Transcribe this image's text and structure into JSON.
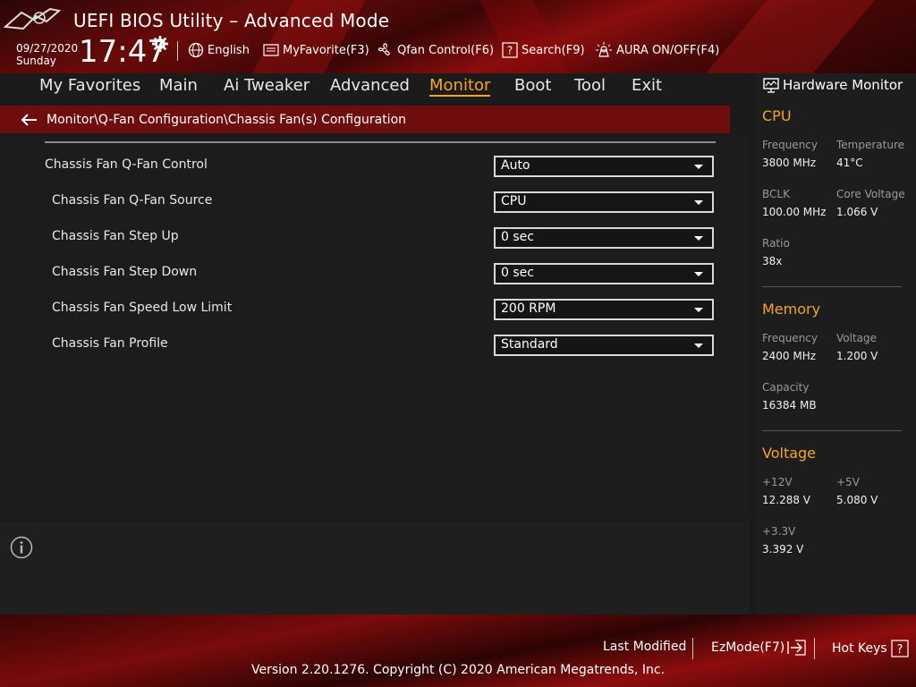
{
  "header": {
    "title": "UEFI BIOS Utility – Advanced Mode",
    "date": "09/27/2020",
    "day": "Sunday",
    "time": "17:47",
    "toolbar": [
      {
        "label": "English",
        "icon": "globe-icon"
      },
      {
        "label": "MyFavorite(F3)",
        "icon": "favorite-icon"
      },
      {
        "label": "Qfan Control(F6)",
        "icon": "fan-icon"
      },
      {
        "label": "Search(F9)",
        "icon": "search-icon"
      },
      {
        "label": "AURA ON/OFF(F4)",
        "icon": "aura-icon"
      }
    ]
  },
  "nav": {
    "items": [
      "My Favorites",
      "Main",
      "Ai Tweaker",
      "Advanced",
      "Monitor",
      "Boot",
      "Tool",
      "Exit"
    ],
    "active": "Monitor"
  },
  "breadcrumb": "Monitor\\Q-Fan Configuration\\Chassis Fan(s) Configuration",
  "settings": [
    {
      "label": "Chassis Fan Q-Fan Control",
      "value": "Auto"
    },
    {
      "label": "Chassis Fan Q-Fan Source",
      "value": "CPU"
    },
    {
      "label": "Chassis Fan Step Up",
      "value": "0 sec"
    },
    {
      "label": "Chassis Fan Step Down",
      "value": "0 sec"
    },
    {
      "label": "Chassis Fan Speed Low Limit",
      "value": "200 RPM"
    },
    {
      "label": "Chassis Fan Profile",
      "value": "Standard"
    }
  ],
  "hw_monitor": {
    "title": "Hardware Monitor",
    "cpu": {
      "heading": "CPU",
      "frequency_label": "Frequency",
      "frequency": "3800 MHz",
      "temperature_label": "Temperature",
      "temperature": "41°C",
      "bclk_label": "BCLK",
      "bclk": "100.00 MHz",
      "core_voltage_label": "Core Voltage",
      "core_voltage": "1.066 V",
      "ratio_label": "Ratio",
      "ratio": "38x"
    },
    "memory": {
      "heading": "Memory",
      "frequency_label": "Frequency",
      "frequency": "2400 MHz",
      "voltage_label": "Voltage",
      "voltage": "1.200 V",
      "capacity_label": "Capacity",
      "capacity": "16384 MB"
    },
    "voltage": {
      "heading": "Voltage",
      "v12_label": "+12V",
      "v12": "12.288 V",
      "v5_label": "+5V",
      "v5": "5.080 V",
      "v33_label": "+3.3V",
      "v33": "3.392 V"
    }
  },
  "footer": {
    "last_modified": "Last Modified",
    "ezmode": "EzMode(F7)",
    "hot_keys": "Hot Keys",
    "copyright": "Version 2.20.1276. Copyright (C) 2020 American Megatrends, Inc."
  },
  "colors": {
    "accent": "#f5a623",
    "breadcrumb_bg": "#6e0d0d",
    "brand_red": "#8b0d0d"
  }
}
